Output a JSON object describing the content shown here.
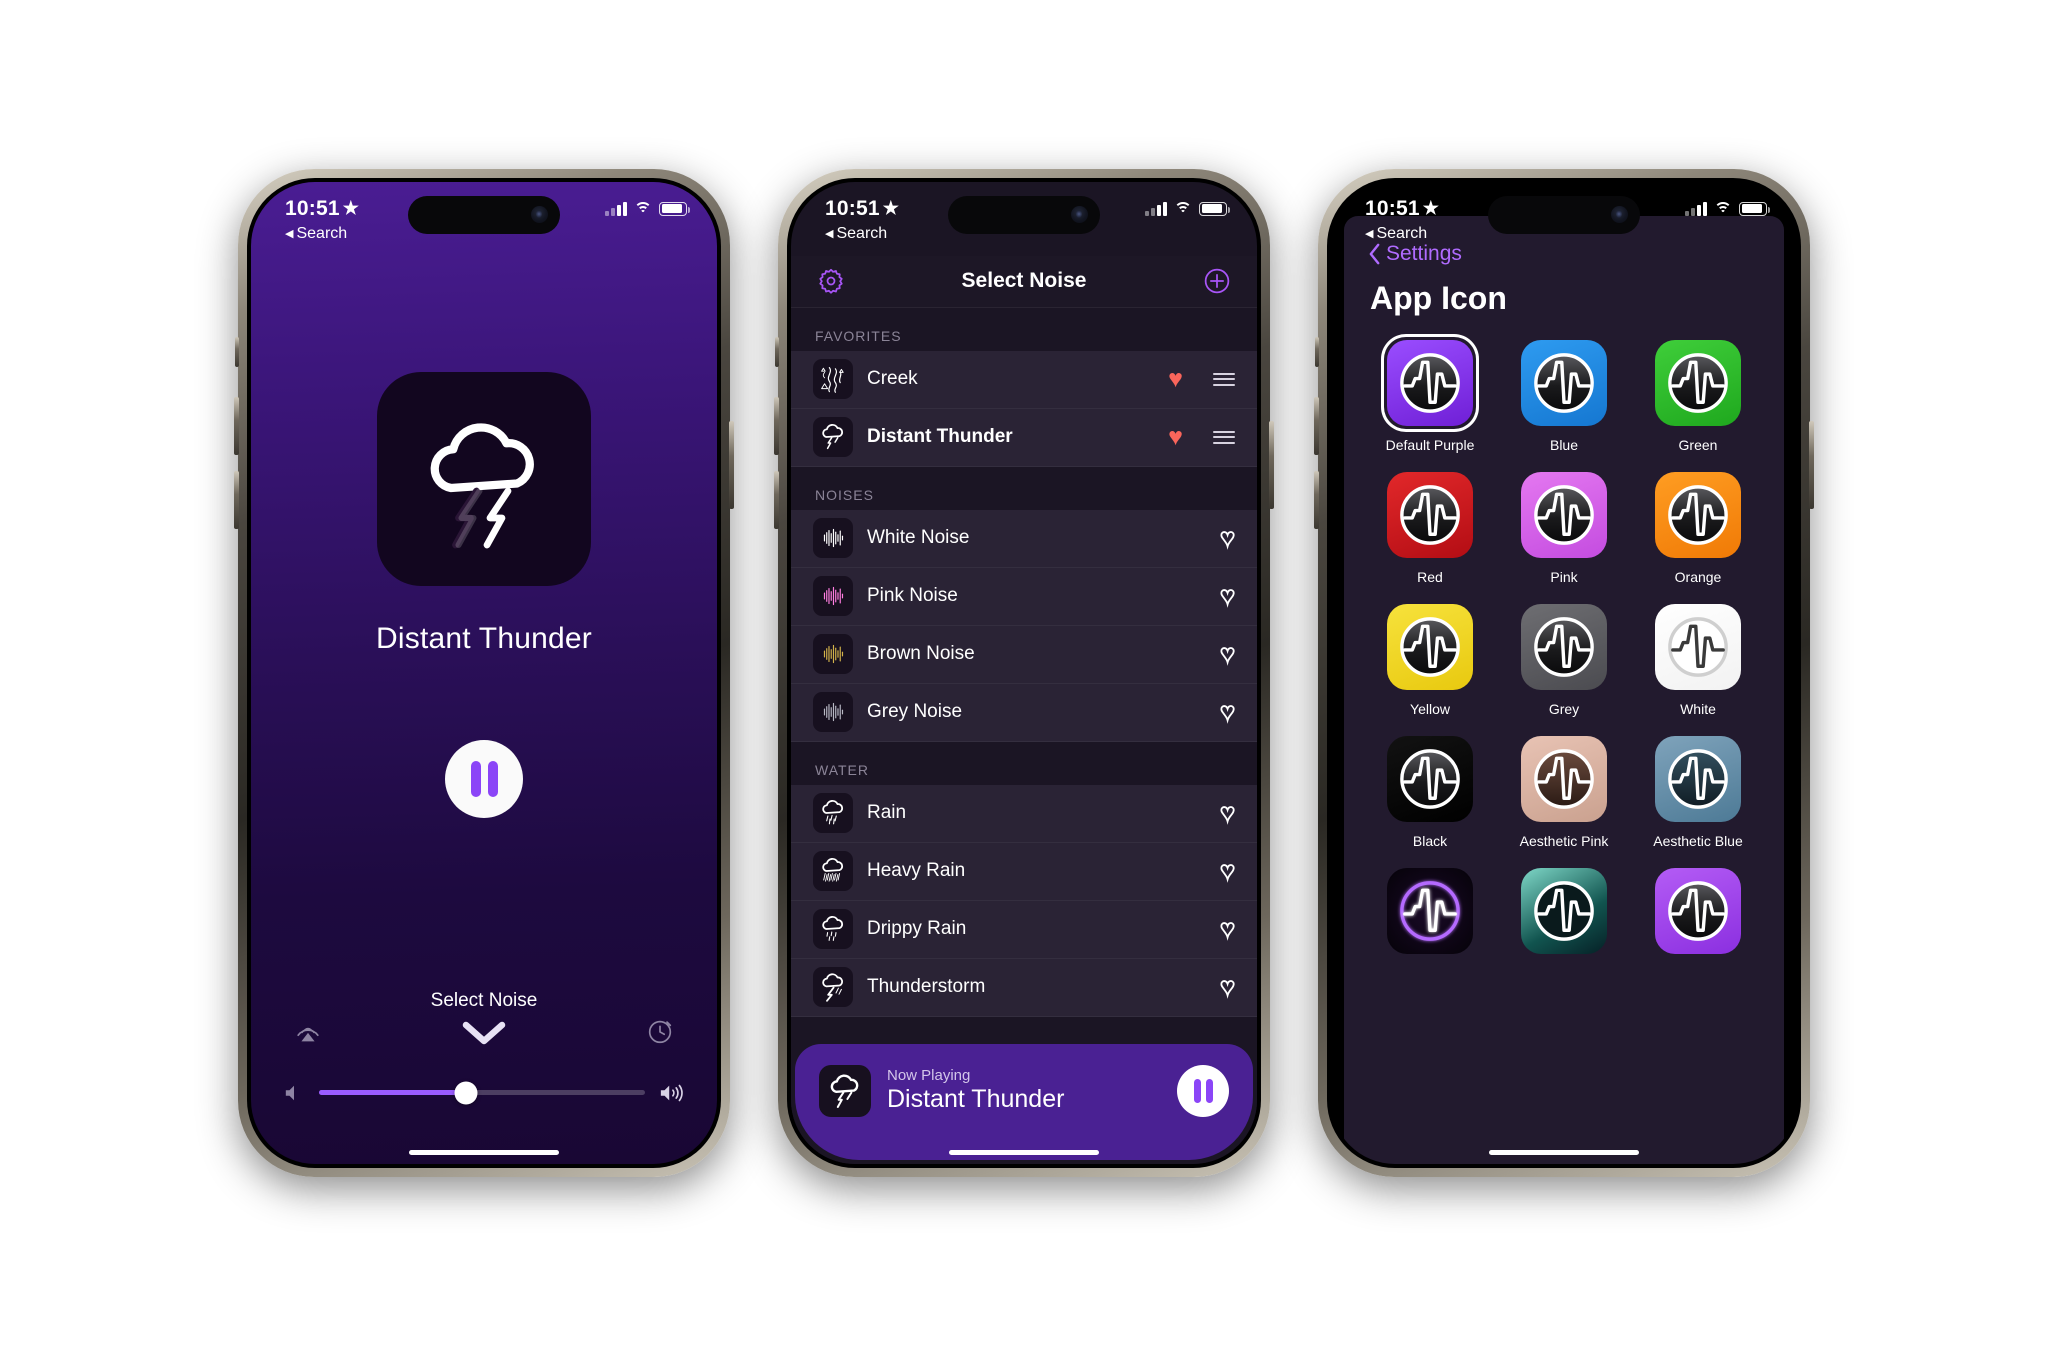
{
  "status_bar": {
    "time": "10:51",
    "star_icon": "star-filled-icon",
    "back_label": "Search",
    "cell_icon": "cellular-signal-icon",
    "wifi_icon": "wifi-icon",
    "battery_icon": "battery-icon"
  },
  "player": {
    "artwork_icon": "cloud-lightning-icon",
    "track_title": "Distant Thunder",
    "play_state": "playing",
    "pause_icon": "pause-icon",
    "select_noise_label": "Select Noise",
    "chevron_icon": "chevron-down-icon",
    "airplay_icon": "airplay-icon",
    "timer_icon": "timer-icon",
    "volume_low_icon": "speaker-low-icon",
    "volume_high_icon": "speaker-high-icon",
    "volume_percent": 45,
    "accent_color": "#8b45f7",
    "background_top_color": "#4a1d93",
    "background_bottom_color": "#190734"
  },
  "list_screen": {
    "settings_icon": "gear-icon",
    "title": "Select Noise",
    "add_icon": "plus-circle-icon",
    "accent_color": "#a855f7",
    "favorite_color": "#f9655b",
    "sections": [
      {
        "header": "FAVORITES",
        "items": [
          {
            "name": "Creek",
            "icon": "creek-stream-icon",
            "favorite": true,
            "reorderable": true,
            "selected": false
          },
          {
            "name": "Distant Thunder",
            "icon": "cloud-lightning-icon",
            "favorite": true,
            "reorderable": true,
            "selected": true
          }
        ]
      },
      {
        "header": "NOISES",
        "items": [
          {
            "name": "White Noise",
            "icon": "waveform-bars-icon",
            "wave_color": "#ffffff",
            "favorite": false
          },
          {
            "name": "Pink Noise",
            "icon": "waveform-bars-icon",
            "wave_color": "#ff7de0",
            "favorite": false
          },
          {
            "name": "Brown Noise",
            "icon": "waveform-bars-icon",
            "wave_color": "#d2b24a",
            "favorite": false
          },
          {
            "name": "Grey Noise",
            "icon": "waveform-bars-icon",
            "wave_color": "#b8b8c4",
            "favorite": false
          }
        ]
      },
      {
        "header": "WATER",
        "items": [
          {
            "name": "Rain",
            "icon": "cloud-rain-icon",
            "favorite": false
          },
          {
            "name": "Heavy Rain",
            "icon": "cloud-heavy-rain-icon",
            "favorite": false
          },
          {
            "name": "Drippy Rain",
            "icon": "cloud-drizzle-icon",
            "favorite": false
          },
          {
            "name": "Thunderstorm",
            "icon": "cloud-bolt-rain-icon",
            "favorite": false
          }
        ]
      }
    ],
    "now_playing": {
      "subtitle": "Now Playing",
      "title": "Distant Thunder",
      "icon": "cloud-lightning-icon",
      "pause_icon": "pause-icon",
      "bar_color": "#4a2193"
    }
  },
  "app_icon_screen": {
    "back_label": "Settings",
    "back_icon": "chevron-left-icon",
    "title": "App Icon",
    "selected_icon": "Default Purple",
    "icons": [
      {
        "label": "Default Purple",
        "bg": "linear-gradient(160deg,#9a4dff,#6f1fd6)",
        "circle": "dark",
        "selected": true
      },
      {
        "label": "Blue",
        "bg": "linear-gradient(160deg,#2e9bf0,#1577d1)",
        "circle": "dark",
        "selected": false
      },
      {
        "label": "Green",
        "bg": "linear-gradient(160deg,#3fce3a,#1fa81e)",
        "circle": "dark",
        "selected": false
      },
      {
        "label": "Red",
        "bg": "linear-gradient(160deg,#e2282a,#b30d14)",
        "circle": "dark",
        "selected": false
      },
      {
        "label": "Pink",
        "bg": "linear-gradient(160deg,#e478f0,#c44ce0)",
        "circle": "dark",
        "selected": false
      },
      {
        "label": "Orange",
        "bg": "linear-gradient(160deg,#ff9d22,#f07a06)",
        "circle": "dark",
        "selected": false
      },
      {
        "label": "Yellow",
        "bg": "linear-gradient(160deg,#f7e23c,#e8c90f)",
        "circle": "dark",
        "selected": false
      },
      {
        "label": "Grey",
        "bg": "linear-gradient(160deg,#6e6e72,#4b4b50)",
        "circle": "dark",
        "selected": false
      },
      {
        "label": "White",
        "bg": "linear-gradient(160deg,#ffffff,#f2f2f2)",
        "circle": "white",
        "selected": false
      },
      {
        "label": "Black",
        "bg": "linear-gradient(160deg,#121212,#000000)",
        "circle": "dark",
        "selected": false
      },
      {
        "label": "Aesthetic Pink",
        "bg": "linear-gradient(160deg,#e8c3b4,#caa18f)",
        "circle": "warm",
        "selected": false
      },
      {
        "label": "Aesthetic Blue",
        "bg": "linear-gradient(160deg,#7fa3bb,#4d7a96)",
        "circle": "cool",
        "selected": false
      },
      {
        "label": "",
        "bg": "radial-gradient(circle at 50% 50%,#1a0a28,#050208)",
        "circle": "neon",
        "selected": false
      },
      {
        "label": "",
        "bg": "linear-gradient(150deg,#7fd8c8,#11544f 60%,#062026)",
        "circle": "aurora",
        "selected": false
      },
      {
        "label": "",
        "bg": "linear-gradient(160deg,#b45cf5,#8b2fe0)",
        "circle": "dark",
        "selected": false
      }
    ]
  }
}
